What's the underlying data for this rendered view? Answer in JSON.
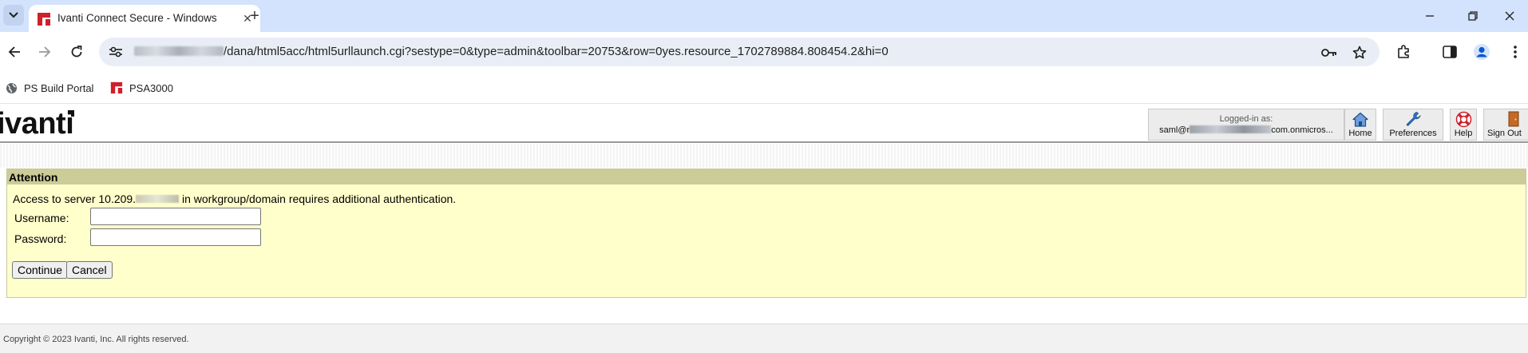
{
  "browser": {
    "tab": {
      "title": "Ivanti Connect Secure - Windows",
      "favicon": "ivanti-favicon",
      "close_glyph": "✕"
    },
    "new_tab_glyph": "+",
    "window_controls": {
      "minimize": "minimize-icon",
      "restore": "restore-icon",
      "close": "close-icon"
    },
    "address_bar": {
      "url_suffix": "/dana/html5acc/html5urllaunch.cgi?sestype=0&type=admin&toolbar=20753&row=0yes.resource_1702789884.808454.2&hi=0"
    },
    "bookmarks": [
      {
        "label": "PS Build Portal",
        "icon": "globe-icon"
      },
      {
        "label": "PSA3000",
        "icon": "ivanti-favicon"
      }
    ]
  },
  "header": {
    "logo_text": "ivanti",
    "user": {
      "label": "Logged-in as:",
      "account_prefix": "saml@r",
      "account_suffix": "com.onmicros..."
    },
    "buttons": {
      "home": "Home",
      "preferences": "Preferences",
      "help": "Help",
      "sign_out": "Sign Out"
    }
  },
  "attention": {
    "title": "Attention",
    "message_prefix": "Access to server 10.209.",
    "message_suffix": "in workgroup/domain requires additional authentication.",
    "username_label": "Username:",
    "password_label": "Password:",
    "username_value": "",
    "password_value": "",
    "continue_label": "Continue",
    "cancel_label": "Cancel"
  },
  "footer": {
    "copyright": "Copyright © 2023 Ivanti, Inc. All rights reserved."
  },
  "colors": {
    "tabstrip": "#d3e3fd",
    "panel_bg": "#ffffcc",
    "panel_head": "#cccc99",
    "brand_red": "#d0202a"
  }
}
